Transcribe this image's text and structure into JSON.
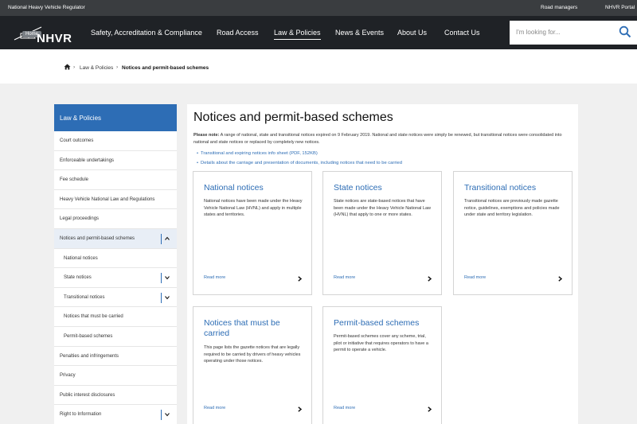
{
  "topbar": {
    "site_name": "National Heavy Vehicle Regulator",
    "links": [
      "Road managers",
      "NHVR Portal"
    ]
  },
  "header": {
    "logo_text": "NHVR",
    "home_badge": "Home",
    "nav": [
      "Safety, Accreditation & Compliance",
      "Road Access",
      "Law & Policies",
      "News & Events",
      "About Us",
      "Contact Us"
    ],
    "active_nav": "Law & Policies",
    "search_placeholder": "I'm looking for..."
  },
  "breadcrumb": {
    "items": [
      "Law & Policies",
      "Notices and permit-based schemes"
    ]
  },
  "sidebar": {
    "heading": "Law & Policies",
    "items": [
      {
        "label": "Court outcomes",
        "level": 0,
        "toggle": "none"
      },
      {
        "label": "Enforceable undertakings",
        "level": 0,
        "toggle": "none"
      },
      {
        "label": "Fee schedule",
        "level": 0,
        "toggle": "none"
      },
      {
        "label": "Heavy Vehicle National Law and Regulations",
        "level": 0,
        "toggle": "none"
      },
      {
        "label": "Legal proceedings",
        "level": 0,
        "toggle": "none"
      },
      {
        "label": "Notices and permit-based schemes",
        "level": 0,
        "toggle": "up",
        "active": true
      },
      {
        "label": "National notices",
        "level": 1,
        "toggle": "none"
      },
      {
        "label": "State notices",
        "level": 1,
        "toggle": "down"
      },
      {
        "label": "Transitional notices",
        "level": 1,
        "toggle": "down"
      },
      {
        "label": "Notices that must be carried",
        "level": 1,
        "toggle": "none"
      },
      {
        "label": "Permit-based schemes",
        "level": 1,
        "toggle": "none"
      },
      {
        "label": "Penalties and infringements",
        "level": 0,
        "toggle": "none"
      },
      {
        "label": "Privacy",
        "level": 0,
        "toggle": "none"
      },
      {
        "label": "Public interest disclosures",
        "level": 0,
        "toggle": "none"
      },
      {
        "label": "Right to Information",
        "level": 0,
        "toggle": "down"
      }
    ]
  },
  "main": {
    "title": "Notices and permit-based schemes",
    "note_label": "Please note:",
    "note_text": " A range of national, state and transitional notices expired on 9 February 2019. National and state notices were simply be renewed, but transitional notices were consolidated into national and state notices or replaced by completely new notices.",
    "links": [
      "Transitional and expiring notices info sheet (PDF, 152KB)",
      "Details about the carriage and presentation of documents, including notices that need to be carried"
    ],
    "cards": [
      {
        "title": "National notices",
        "desc": "National notices have been made under the Heavy Vehicle National Law (HVNL) and apply in multiple states and territories.",
        "link": "Read more"
      },
      {
        "title": "State notices",
        "desc": "State notices are state-based notices that have been made under the Heavy Vehicle National Law (HVNL) that apply to one or more states.",
        "link": "Read more"
      },
      {
        "title": "Transitional notices",
        "desc": "Transitional notices are previously made gazette notice, guidelines, exemptions and policies made under state and territory legislation.",
        "link": "Read more"
      },
      {
        "title": "Notices that must be carried",
        "desc": "This page lists the gazette notices that are legally required to be carried by drivers of heavy vehicles operating under those notices.",
        "link": "Read more"
      },
      {
        "title": "Permit-based schemes",
        "desc": "Permit-based schemes cover any scheme, trial, pilot or initiative that requires operators to have a permit to operate a vehicle.",
        "link": "Read more"
      }
    ]
  },
  "colors": {
    "accent": "#2d6db5",
    "nav_bg": "#1f2226",
    "topbar_bg": "#3a3d40"
  }
}
